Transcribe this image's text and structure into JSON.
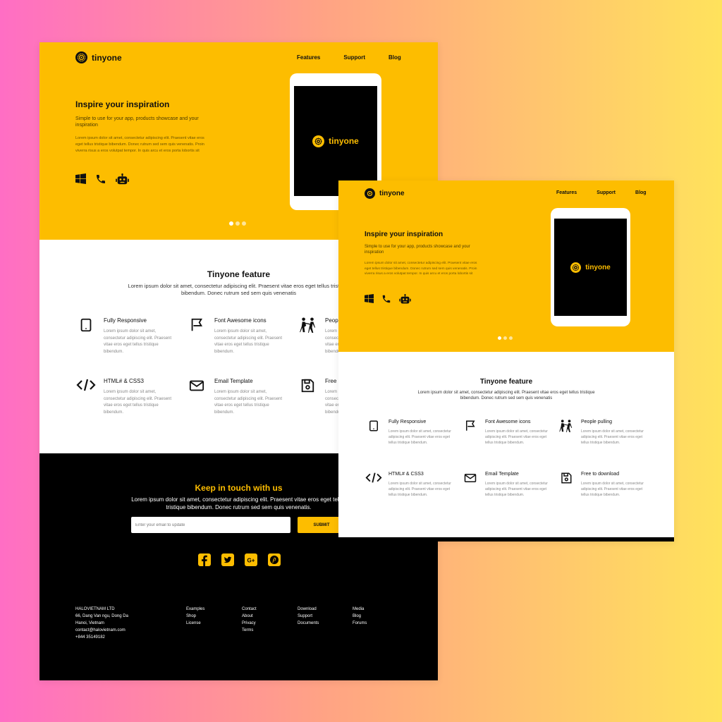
{
  "brand": {
    "name": "tinyone",
    "accent": "#fdbd00",
    "dark": "#000000"
  },
  "nav": [
    "Features",
    "Support",
    "Blog"
  ],
  "hero": {
    "title": "Inspire your inspiration",
    "subtitle": "Simple to use for your app, products showcase and your inspiration",
    "body": "Lorem ipsum dolor sit amet, consectetur adipiscing elit. Praesent vitae eros eget tellus tristique bibendum. Donec rutrum sed sem quis venenatis. Proin viverra risus a eros volutpat tempor. In quis arcu et eros porta lobortis sit",
    "icons": [
      "windows-icon",
      "phone-icon",
      "robot-icon"
    ],
    "slides_total": 3,
    "slide_active": 1
  },
  "features": {
    "title": "Tinyone feature",
    "intro": "Lorem ipsum dolor sit amet, consectetur adipiscing elit. Praesent vitae eros eget tellus tristique bibendum. Donec rutrum sed sem quis venenatis",
    "item_text": "Lorem ipsum dolor sit amet, consectetur adipiscing elit. Praesent vitae eros eget tellus tristique bibendum.",
    "items": [
      {
        "title": "Fully Responsive",
        "icon": "tablet-icon"
      },
      {
        "title": "Font Awesome icons",
        "icon": "flag-icon"
      },
      {
        "title": "People pulling",
        "icon": "people-pulling-icon"
      },
      {
        "title": "HTML# & CSS3",
        "icon": "code-icon"
      },
      {
        "title": "Email Template",
        "icon": "envelope-icon"
      },
      {
        "title": "Free to download",
        "icon": "floppy-disk-icon"
      }
    ],
    "clipped_titles": [
      "Peop",
      "Free"
    ]
  },
  "contact": {
    "title": "Keep in touch with us",
    "intro": "Lorem ipsum dolor sit amet, consectetur adipiscing elit. Praesent vitae eros eget tellus tristique bibendum. Donec rutrum sed sem quis venenatis.",
    "email_placeholder": "Enter your email to update",
    "submit_label": "SUBMIT",
    "social": [
      "facebook-icon",
      "twitter-icon",
      "google-plus-icon",
      "pinterest-icon"
    ]
  },
  "footer": {
    "company": [
      "HALOVIETNAM LTD",
      "66, Dang Van ngu, Dong Da",
      "Hanoi, Vietnam",
      "contact@halovietnam.com",
      "+844 35149182"
    ],
    "columns": [
      [
        "Examples",
        "Shop",
        "License"
      ],
      [
        "Contact",
        "About",
        "Privacy",
        "Terms"
      ],
      [
        "Download",
        "Support",
        "Documents"
      ],
      [
        "Media",
        "Blog",
        "Forums"
      ]
    ]
  }
}
